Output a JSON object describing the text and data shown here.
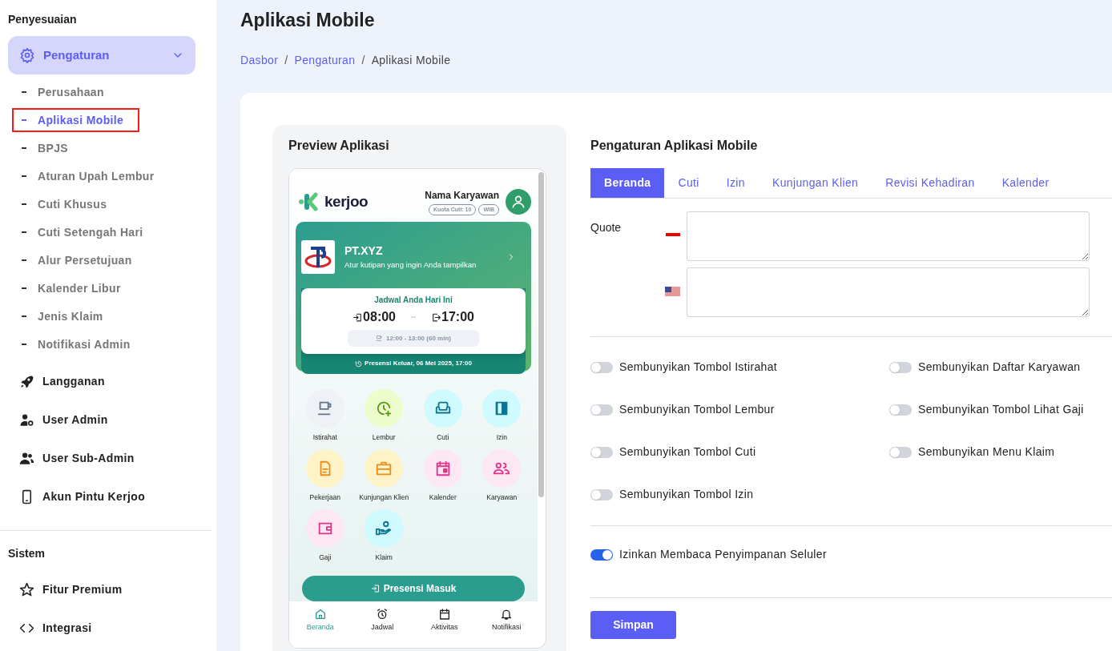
{
  "sidebar": {
    "sections": [
      {
        "title": "Penyesuaian",
        "items": [
          {
            "kind": "group",
            "label": "Pengaturan",
            "expanded": true,
            "children": [
              {
                "label": "Perusahaan",
                "selected": false,
                "annotated": false
              },
              {
                "label": "Aplikasi Mobile",
                "selected": true,
                "annotated": true
              },
              {
                "label": "BPJS",
                "selected": false,
                "annotated": false
              },
              {
                "label": "Aturan Upah Lembur",
                "selected": false,
                "annotated": false
              },
              {
                "label": "Cuti Khusus",
                "selected": false,
                "annotated": false
              },
              {
                "label": "Cuti Setengah Hari",
                "selected": false,
                "annotated": false
              },
              {
                "label": "Alur Persetujuan",
                "selected": false,
                "annotated": false
              },
              {
                "label": "Kalender Libur",
                "selected": false,
                "annotated": false
              },
              {
                "label": "Jenis Klaim",
                "selected": false,
                "annotated": false
              },
              {
                "label": "Notifikasi Admin",
                "selected": false,
                "annotated": false
              }
            ]
          },
          {
            "kind": "link",
            "label": "Langganan"
          },
          {
            "kind": "link",
            "label": "User Admin"
          },
          {
            "kind": "link",
            "label": "User Sub-Admin"
          },
          {
            "kind": "link",
            "label": "Akun Pintu Kerjoo"
          }
        ]
      },
      {
        "title": "Sistem",
        "items": [
          {
            "kind": "link",
            "label": "Fitur Premium"
          },
          {
            "kind": "link",
            "label": "Integrasi"
          }
        ]
      }
    ]
  },
  "page": {
    "title": "Aplikasi Mobile",
    "breadcrumb": [
      {
        "kind": "link",
        "label": "Dasbor"
      },
      {
        "kind": "separator",
        "label": "/"
      },
      {
        "kind": "link",
        "label": "Pengaturan"
      },
      {
        "kind": "separator",
        "label": "/"
      },
      {
        "kind": "current",
        "label": "Aplikasi Mobile"
      }
    ]
  },
  "preview": {
    "title": "Preview Aplikasi",
    "phone": {
      "logo_text": "kerjoo",
      "user_name": "Nama Karyawan",
      "badges": [
        "Kuota Cuti: 10",
        "WIB"
      ],
      "company": {
        "name": "PT.XYZ",
        "quote": "Atur kutipan yang ingin Anda tampilkan"
      },
      "schedule": {
        "title": "Jadwal Anda Hari Ini",
        "clock_in": "08:00",
        "clock_out": "17:00",
        "break": "12:00 - 13:00 (60 min)",
        "last_attendance": "Presensi Keluar, 06 Mei 2025, 17:00"
      },
      "menu": [
        "Istirahat",
        "Lembur",
        "Cuti",
        "Izin",
        "Pekerjaan",
        "Kunjungan Klien",
        "Kalender",
        "Karyawan",
        "Gaji",
        "Klaim"
      ],
      "action_button": "Presensi Masuk",
      "nav": [
        {
          "label": "Beranda",
          "selected": true
        },
        {
          "label": "Jadwal",
          "selected": false
        },
        {
          "label": "Aktivitas",
          "selected": false
        },
        {
          "label": "Notifikasi",
          "selected": false
        }
      ]
    }
  },
  "settings": {
    "title": "Pengaturan Aplikasi Mobile",
    "tabs": [
      {
        "label": "Beranda",
        "selected": true
      },
      {
        "label": "Cuti",
        "selected": false
      },
      {
        "label": "Izin",
        "selected": false
      },
      {
        "label": "Kunjungan Klien",
        "selected": false
      },
      {
        "label": "Revisi Kehadiran",
        "selected": false
      },
      {
        "label": "Kalender",
        "selected": false
      }
    ],
    "quote_label": "Quote",
    "toggles": [
      {
        "label": "Sembunyikan Tombol Istirahat",
        "on": false
      },
      {
        "label": "Sembunyikan Daftar Karyawan",
        "on": false
      },
      {
        "label": "Sembunyikan Tombol Lembur",
        "on": false
      },
      {
        "label": "Sembunyikan Tombol Lihat Gaji",
        "on": false
      },
      {
        "label": "Sembunyikan Tombol Cuti",
        "on": false
      },
      {
        "label": "Sembunyikan Menu Klaim",
        "on": false
      },
      {
        "label": "Sembunyikan Tombol Izin",
        "on": false
      }
    ],
    "storage_toggle": {
      "label": "Izinkan Membaca Penyimpanan Seluler",
      "on": true
    },
    "save_button": "Simpan"
  }
}
